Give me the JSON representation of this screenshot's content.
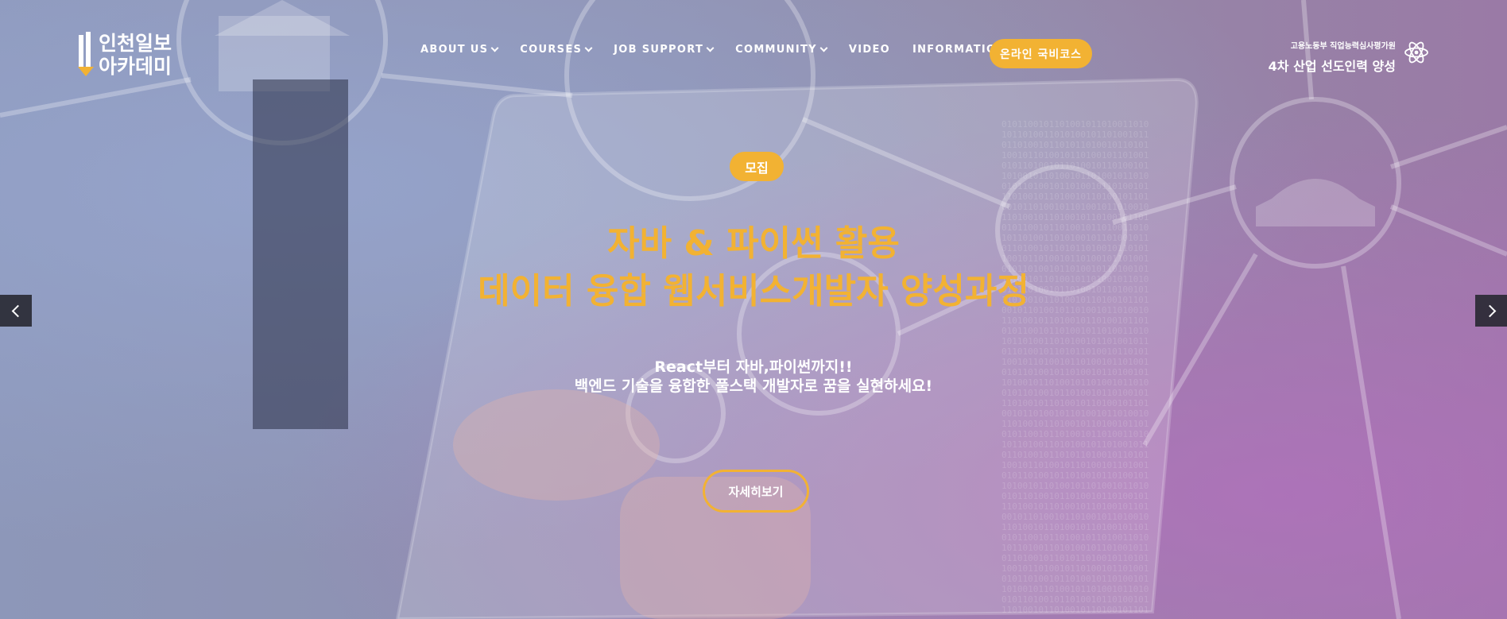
{
  "brand": {
    "name_line1": "인천일보",
    "name_line2": "아카데미",
    "accent_color": "#f2b233"
  },
  "nav": {
    "items": [
      {
        "label": "ABOUT US",
        "has_dropdown": true
      },
      {
        "label": "COURSES",
        "has_dropdown": true
      },
      {
        "label": "JOB SUPPORT",
        "has_dropdown": true
      },
      {
        "label": "COMMUNITY",
        "has_dropdown": true
      },
      {
        "label": "VIDEO",
        "has_dropdown": false
      },
      {
        "label": "INFORMATION",
        "has_dropdown": true
      }
    ],
    "cta_label": "온라인 국비코스"
  },
  "right_tag": {
    "small": "고용노동부 직업능력심사평가원",
    "big": "4차 산업 선도인력 양성",
    "icon": "atom-icon"
  },
  "hero": {
    "badge": "모집",
    "title_line1": "자바 & 파이썬 활용",
    "title_line2": "데이터 융합 웹서비스개발자 양성과정",
    "sub_line1": "React부터 자바,파이썬까지!!",
    "sub_line2": "백엔드 기술을 융합한 풀스택 개발자로 꿈을 실현하세요!",
    "button_label": "자세히보기"
  },
  "slider": {
    "prev_icon": "chevron-left-icon",
    "next_icon": "chevron-right-icon"
  }
}
